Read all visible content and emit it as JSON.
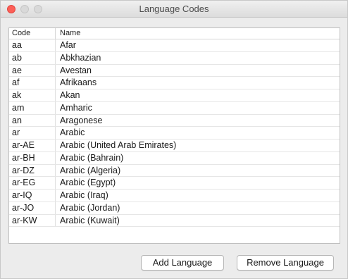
{
  "window": {
    "title": "Language Codes"
  },
  "table": {
    "columns": {
      "code": "Code",
      "name": "Name"
    },
    "rows": [
      {
        "code": "aa",
        "name": "Afar"
      },
      {
        "code": "ab",
        "name": "Abkhazian"
      },
      {
        "code": "ae",
        "name": "Avestan"
      },
      {
        "code": "af",
        "name": "Afrikaans"
      },
      {
        "code": "ak",
        "name": "Akan"
      },
      {
        "code": "am",
        "name": "Amharic"
      },
      {
        "code": "an",
        "name": "Aragonese"
      },
      {
        "code": "ar",
        "name": "Arabic"
      },
      {
        "code": "ar-AE",
        "name": "Arabic (United Arab Emirates)"
      },
      {
        "code": "ar-BH",
        "name": "Arabic (Bahrain)"
      },
      {
        "code": "ar-DZ",
        "name": "Arabic (Algeria)"
      },
      {
        "code": "ar-EG",
        "name": "Arabic (Egypt)"
      },
      {
        "code": "ar-IQ",
        "name": "Arabic (Iraq)"
      },
      {
        "code": "ar-JO",
        "name": "Arabic (Jordan)"
      },
      {
        "code": "ar-KW",
        "name": "Arabic (Kuwait)"
      }
    ]
  },
  "buttons": {
    "add": "Add Language",
    "remove": "Remove Language"
  },
  "colors": {
    "close": "#fc5f57",
    "inactive_light": "#d9d9d9",
    "window_bg": "#ececec"
  }
}
